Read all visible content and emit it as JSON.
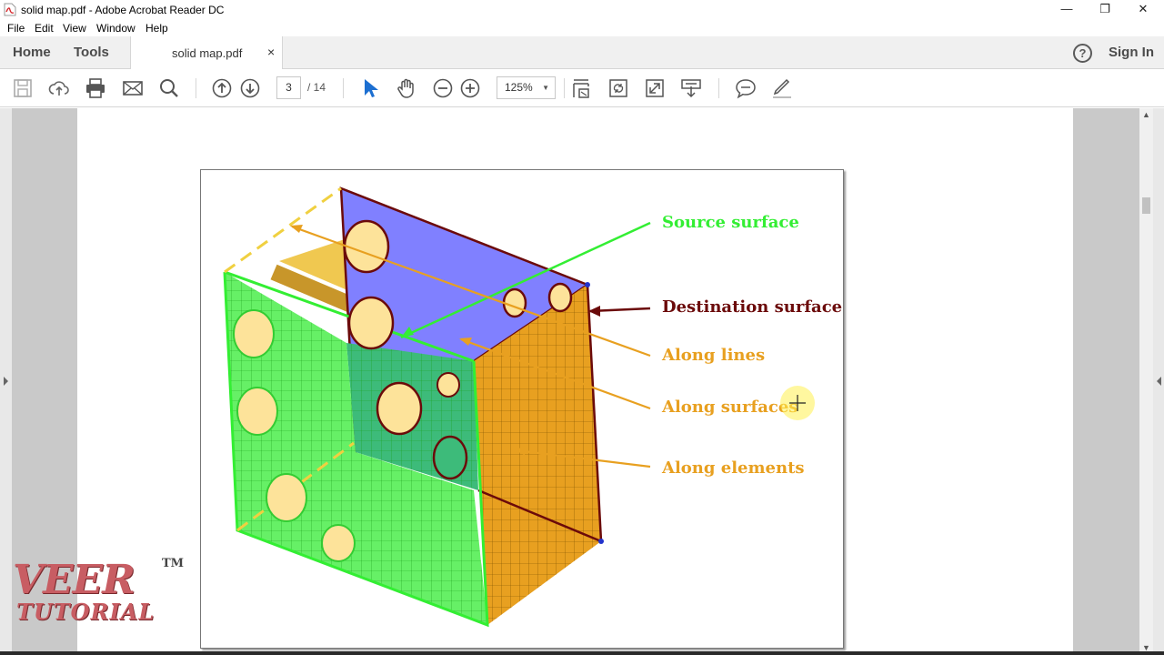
{
  "window": {
    "title": "solid map.pdf - Adobe Acrobat Reader DC",
    "controls": {
      "minimize": "—",
      "restore": "❐",
      "close": "✕"
    }
  },
  "menu": [
    "File",
    "Edit",
    "View",
    "Window",
    "Help"
  ],
  "tabs": {
    "home": "Home",
    "tools": "Tools",
    "document": "solid map.pdf",
    "close": "×"
  },
  "header_right": {
    "help": "?",
    "sign_in": "Sign In"
  },
  "toolbar": {
    "page_current": "3",
    "page_total": "/ 14",
    "zoom": "125%",
    "icons": [
      "save-icon",
      "upload-icon",
      "print-icon",
      "email-icon",
      "search-icon",
      "page-up-icon",
      "page-down-icon",
      "select-arrow-icon",
      "hand-icon",
      "zoom-out-icon",
      "zoom-in-icon",
      "fit-page-icon",
      "rotate-icon",
      "full-screen-icon",
      "read-mode-icon",
      "comment-icon",
      "sign-icon"
    ]
  },
  "figure": {
    "labels": {
      "source": "Source surface",
      "destination": "Destination surface",
      "along_lines": "Along lines",
      "along_surfaces": "Along surfaces",
      "along_elements": "Along elements"
    },
    "colors": {
      "source": "#33ee33",
      "destination": "#6b0a0a",
      "orange": "#e8a020",
      "purple": "#8080ff"
    }
  },
  "watermark": {
    "line1": "VEER",
    "line2": "TUTORIAL",
    "tm": "TM"
  }
}
